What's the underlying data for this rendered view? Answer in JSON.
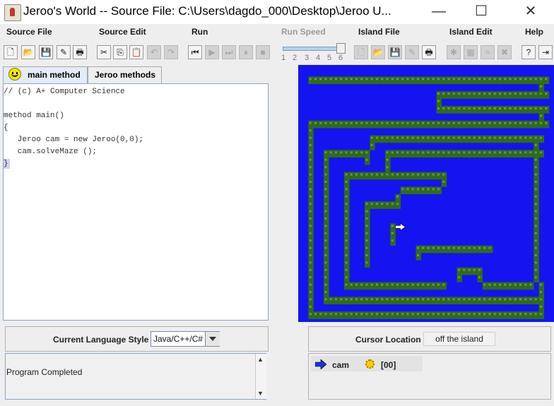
{
  "window": {
    "title": "Jeroo's World -- Source File: C:\\Users\\dagdo_000\\Desktop\\Jeroo U...",
    "minimize_glyph": "—",
    "maximize_glyph": "☐",
    "close_glyph": "✕"
  },
  "menu": [
    {
      "label": "Source File",
      "enabled": true
    },
    {
      "label": "Source Edit",
      "enabled": true
    },
    {
      "label": "Run",
      "enabled": true
    },
    {
      "label": "Run Speed",
      "enabled": false
    },
    {
      "label": "Island File",
      "enabled": true
    },
    {
      "label": "Island Edit",
      "enabled": true
    },
    {
      "label": "Help",
      "enabled": true
    }
  ],
  "toolbar": {
    "icons": [
      {
        "name": "new-file-icon",
        "glyph": "🗋",
        "enabled": true
      },
      {
        "name": "open-file-icon",
        "glyph": "📂",
        "enabled": true
      },
      {
        "name": "save-file-icon",
        "glyph": "💾",
        "enabled": true
      },
      {
        "name": "save-as-icon",
        "glyph": "✎",
        "enabled": true
      },
      {
        "name": "print-icon",
        "glyph": "🖶",
        "enabled": true
      },
      {
        "name": "cut-icon",
        "glyph": "✂",
        "enabled": true
      },
      {
        "name": "copy-icon",
        "glyph": "⎘",
        "enabled": true
      },
      {
        "name": "paste-icon",
        "glyph": "📋",
        "enabled": true
      },
      {
        "name": "undo-icon",
        "glyph": "↶",
        "enabled": false
      },
      {
        "name": "redo-icon",
        "glyph": "↷",
        "enabled": false
      },
      {
        "name": "reset-icon",
        "glyph": "⏮",
        "enabled": true
      },
      {
        "name": "step-icon",
        "glyph": "▶",
        "enabled": false
      },
      {
        "name": "run-continuous-icon",
        "glyph": "⏭",
        "enabled": false
      },
      {
        "name": "pause-icon",
        "glyph": "⏸",
        "enabled": false
      },
      {
        "name": "stop-icon",
        "glyph": "■",
        "enabled": false
      },
      {
        "name": "new-island-icon",
        "glyph": "🗋",
        "enabled": false
      },
      {
        "name": "open-island-icon",
        "glyph": "📂",
        "enabled": false
      },
      {
        "name": "save-island-icon",
        "glyph": "💾",
        "enabled": false
      },
      {
        "name": "save-island-as-icon",
        "glyph": "✎",
        "enabled": false
      },
      {
        "name": "print-island-icon",
        "glyph": "🖶",
        "enabled": true
      },
      {
        "name": "clear-island-icon",
        "glyph": "✱",
        "enabled": false
      },
      {
        "name": "grid-icon",
        "glyph": "▦",
        "enabled": false
      },
      {
        "name": "water-icon",
        "glyph": "≈",
        "enabled": false
      },
      {
        "name": "net-icon",
        "glyph": "✖",
        "enabled": false
      },
      {
        "name": "help-icon",
        "glyph": "?",
        "enabled": true
      },
      {
        "name": "exit-icon",
        "glyph": "⇥",
        "enabled": true
      }
    ]
  },
  "run_speed": {
    "ticks": [
      "1",
      "2",
      "3",
      "4",
      "5",
      "6"
    ],
    "value": 6
  },
  "tabs": [
    {
      "label": "main method",
      "active": true
    },
    {
      "label": "Jeroo methods",
      "active": false
    }
  ],
  "editor": {
    "lines": [
      "// (c) A+ Computer Science",
      "",
      "method main()",
      "{",
      "   Jeroo cam = new Jeroo(0,0);",
      "   cam.solveMaze ();",
      "}"
    ]
  },
  "language": {
    "label": "Current Language Style",
    "value": "Java/C++/C#"
  },
  "output": {
    "text": "Program Completed"
  },
  "cursor": {
    "label": "Cursor Location",
    "value": "off the island"
  },
  "jeroo": {
    "name": "cam",
    "flowers": "[00]"
  },
  "colors": {
    "water": "#1414f0",
    "hedge": "#2f6b1a",
    "hedge_light": "#6a9a3a"
  },
  "island": {
    "rows": [
      "................................................",
      ".###############################################",
      ".~~~~~~~~~~~~~~~~~~~~~~~~~~~~~~~~~~~~~~~~~~~~~#.",
      ".~~~~~~~~~~~~~~~~~~~~~~~~~######################",
      ".~~~~~~~~~~~~~~~~~~~~~~~~~#~~~~~~~~~~~~~~~~~~~~.",
      ".~~~~~~~~~~~~~~~~~~~~~~~~~######################",
      ".~~~~~~~~~~~~~~~~~~~~~~~~~~~~~~~~~~~~~~~~~~~~~#.",
      ".###############################################",
      ".#~~~~~~~~~~~~~~~~~~~~~~~~~~~~~~~~~~~~~~~~~~~~~.",
      ".#~~~~~~~~~~~##################################.",
      ".#~~~~~~~~~~~#~~~~~~~~~~~~~~~~~~~~~~~~~~~~~~~#.",
      ".#~~#########~~~###############################.",
      ".#~~#~~~~~~~#~~~#~~~~~~~~~~~~~~~~~~~~~~~~~~~~#.",
      ".#~~#~~~~~~~~~~~#~~~~~~~~~~~~~~~~~~~~~~~~~~~~#.",
      ".#~~#~~~####################~~~~~~~~~~~~~~~~~#.",
      ".#~~#~~~#~~~~~~~~~~~~~~~~~~#~~~~~~~~~~~~~~~~~#.",
      ".#~~#~~~#~~~~~~~~~~########~~~~~~~~~~~~~~~~~~#.",
      ".#~~#~~~#~~~~~~~~~#~~~~~~~~~~~~~~~~~~~~~~~~~~#.",
      ".#~~#~~~#~~~#######~~~~~~~~~~~~~~~~~~~~~~~~~~#.",
      ".#~~#~~~#~~~#~~~~~~~~~~~~~~~~~~~~~~~~~~~~~~~~#.",
      ".#~~#~~~#~~~#~~~~~~~~~~~~~~~~~~~~~~~~~~~~~~~~#.",
      ".#~~#~~~#~~~#~~~~#J~~~~~~~~~~~~~~~~~~~~~~~~~~#.",
      ".#~~#~~~#~~~#~~~~#~~~~~~~~~~~~~~~~~~~~~~~~~~~#.",
      ".#~~#~~~#~~~#~~~~#~~~~~~~~~~~~~~~~~~~~~~~~~~~#.",
      ".#~~#~~~#~~~#~~~~~~~~~###############~~~~~~~~#.",
      ".#~~#~~~#~~~#~~~~~~~~~#~~~~~~~~~~~~~~~~~~~~~~#.",
      ".#~~#~~~#~~~#~~~~~~~~~~~~~~~~~~~~~~~~~~~~~~~~#.",
      ".#~~#~~~#~~~~~~~~~~~~~~~~~~~~~#####~~~~~~~~~~#.",
      ".#~~#~~~#~~~~~~~~~~~~~~~~~~~~~#~~~#~~~~~~~~~~#.",
      ".#~~#~~~####################~~~~~~~##########~#.",
      ".#~~#~~~~~~~~~~~~~~~~~~~~~~~~~~~~~~~~~~~~~~~~~#.",
      ".#~~###########################################.",
      ".#~~~~~~~~~~~~~~~~~~~~~~~~~~~~~~~~~~~~~~~~~~~~#.",
      ".##############################################."
    ]
  }
}
